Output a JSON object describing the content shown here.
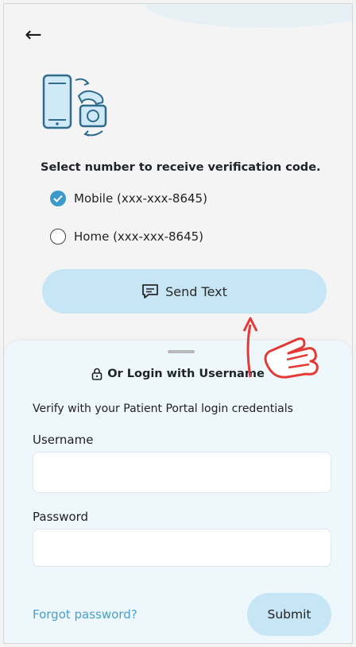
{
  "nav": {
    "back_icon": "arrow-left-icon"
  },
  "illustration": {
    "icon": "phone-and-telephone-icon"
  },
  "prompt": "Select number to receive verification code.",
  "options": [
    {
      "label": "Mobile (xxx-xxx-8645)",
      "checked": true
    },
    {
      "label": "Home (xxx-xxx-8645)",
      "checked": false
    }
  ],
  "send_button": {
    "label": "Send Text",
    "icon": "message-icon"
  },
  "login_sheet": {
    "title": "Or Login with Username",
    "title_icon": "lock-icon",
    "description": "Verify with your Patient Portal login credentials",
    "username_label": "Username",
    "username_value": "",
    "password_label": "Password",
    "password_value": "",
    "forgot_label": "Forgot password?",
    "submit_label": "Submit"
  },
  "colors": {
    "accent": "#3b9ac9",
    "button_bg": "#c6e6f5",
    "sheet_bg": "#eef7fc",
    "link": "#4aa0c9",
    "annotation": "#e53935"
  }
}
